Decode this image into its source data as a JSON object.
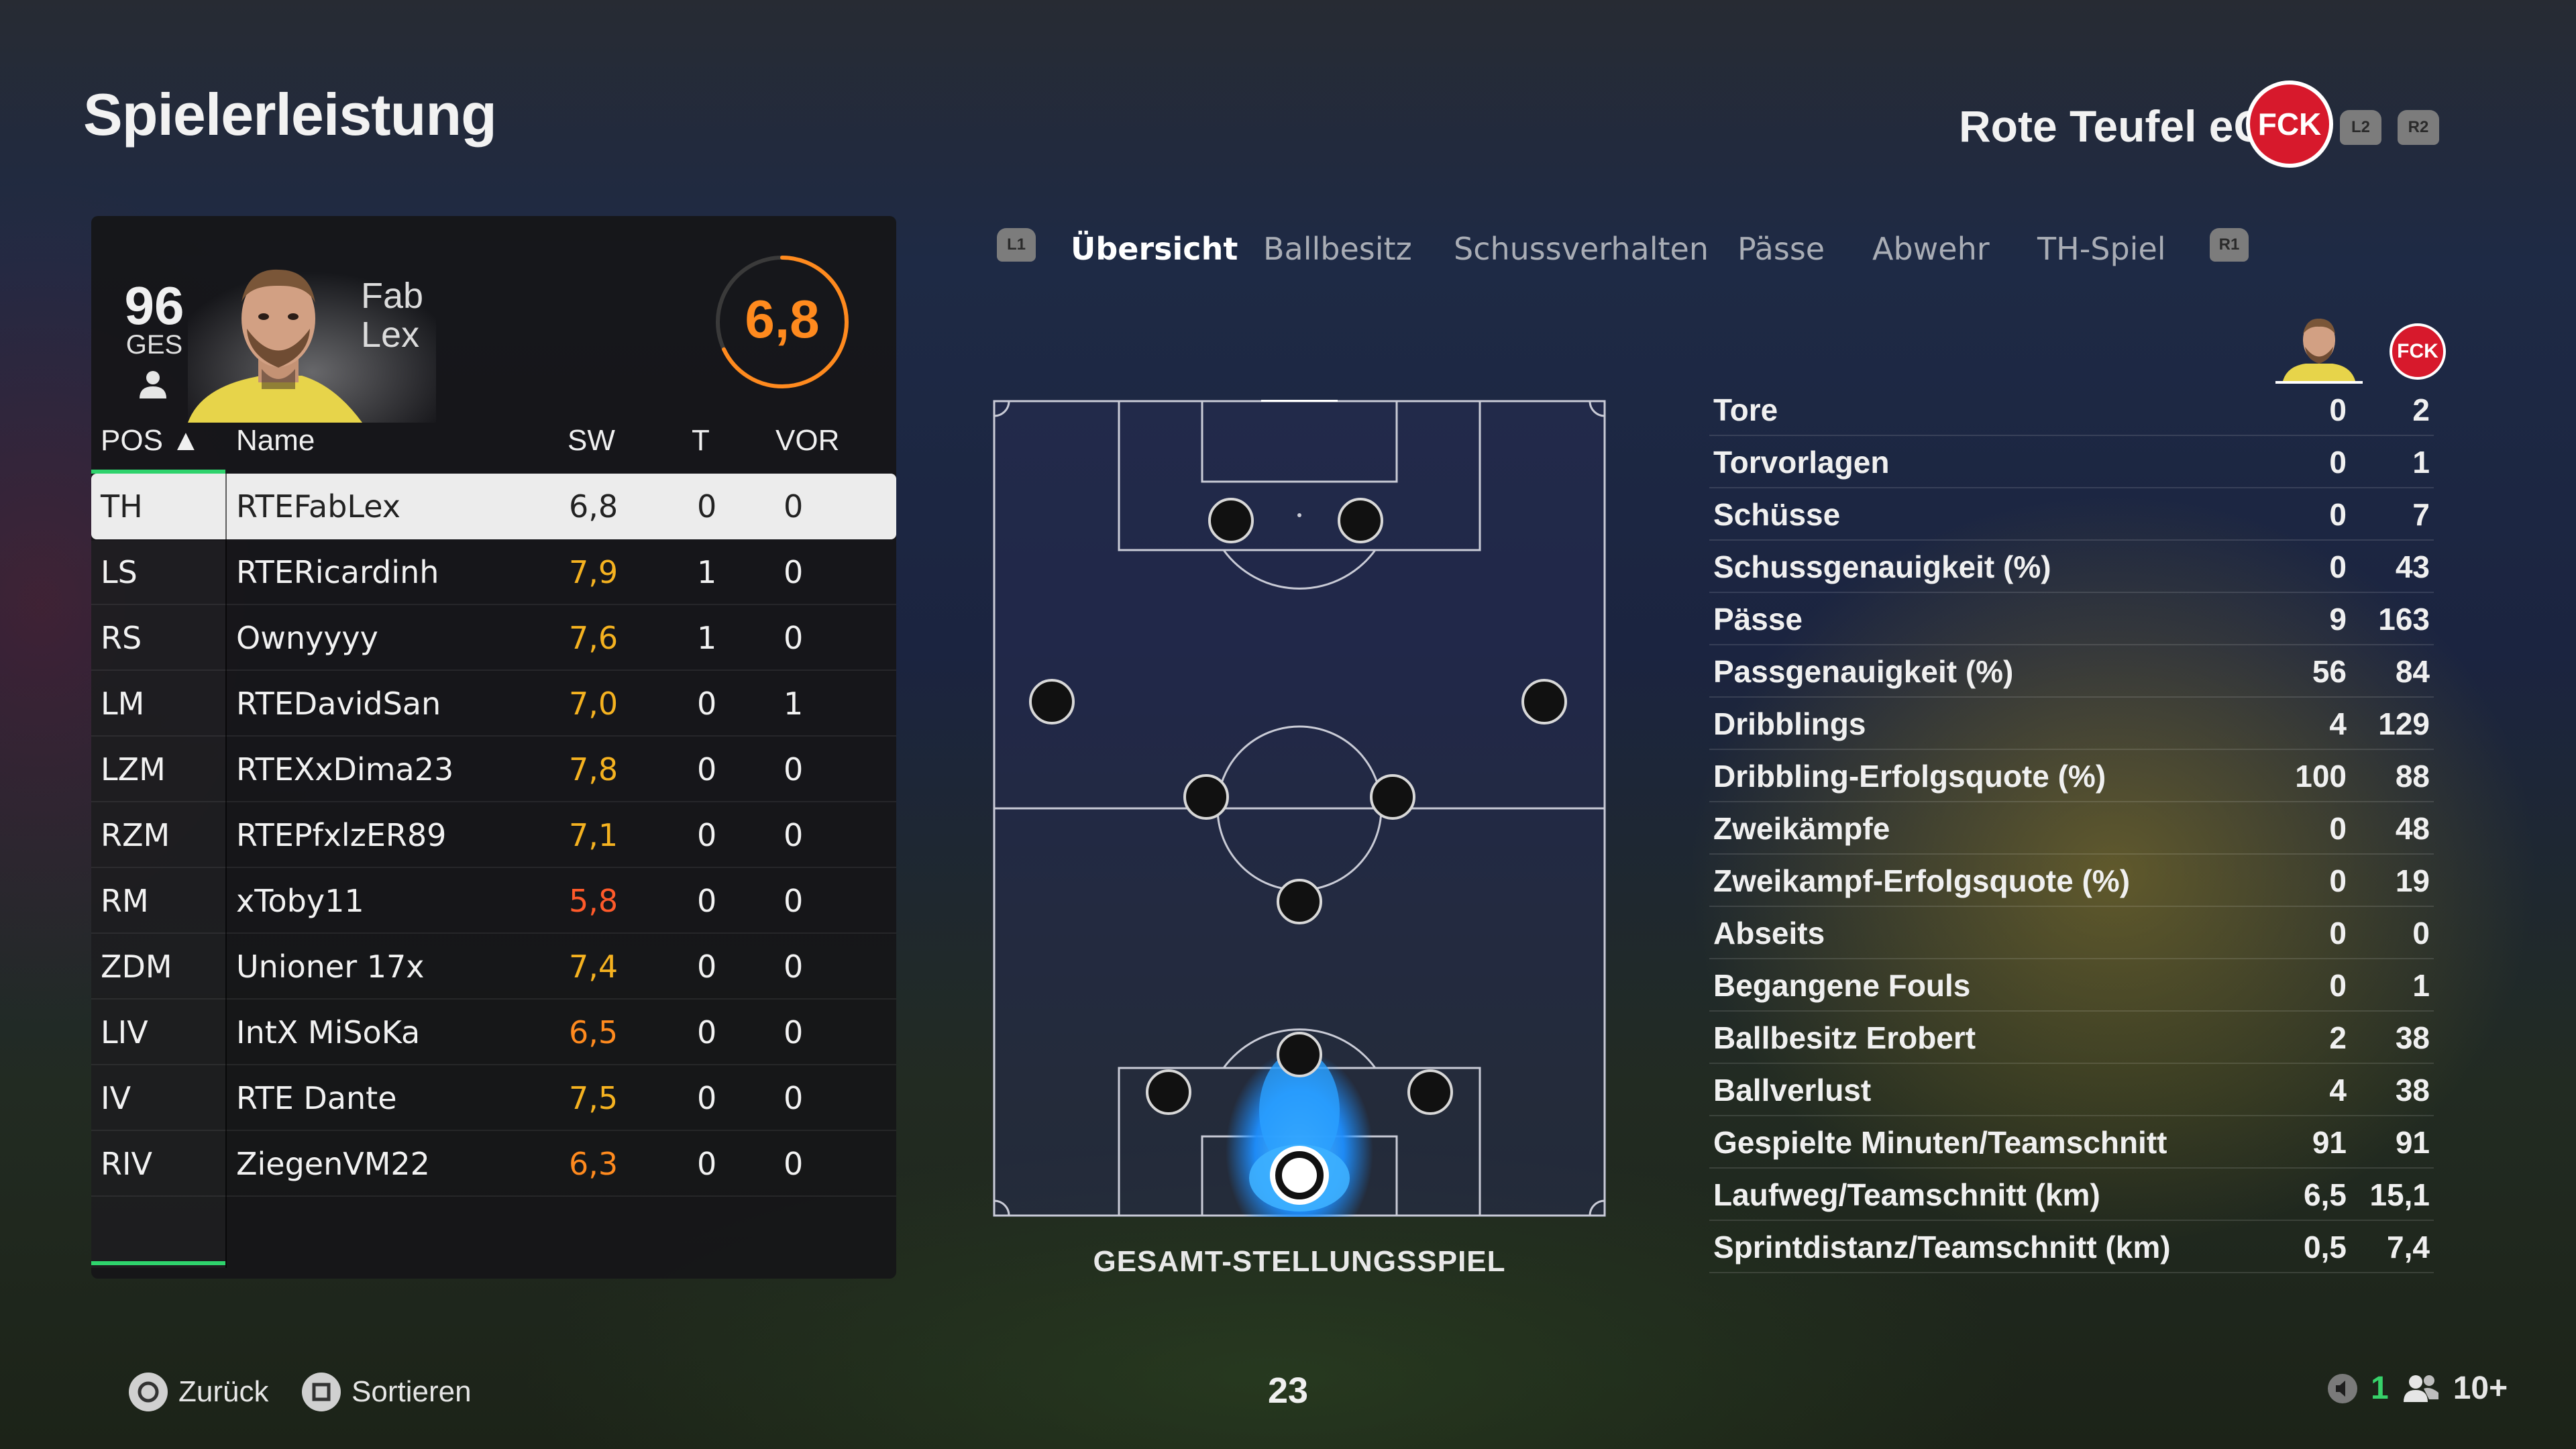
{
  "header": {
    "title": "Spielerleistung",
    "club_name": "Rote Teufel eC",
    "club_logo_text": "FCK",
    "shoulder_left": "L2",
    "shoulder_right": "R2"
  },
  "player_card": {
    "overall": "96",
    "overall_label": "GES",
    "first_name": "Fab",
    "last_name": "Lex",
    "match_rating": "6,8",
    "match_rating_fraction": 0.68,
    "accent_color": "#ff8a1e"
  },
  "table": {
    "headers": {
      "pos": "POS ▲",
      "name": "Name",
      "sw": "SW",
      "t": "T",
      "vor": "VOR"
    },
    "rows": [
      {
        "pos": "TH",
        "name": "RTEFabLex",
        "sw": "6,8",
        "t": "0",
        "vor": "0",
        "sw_color": "#333333",
        "selected": true
      },
      {
        "pos": "LS",
        "name": "RTERicardinh",
        "sw": "7,9",
        "t": "1",
        "vor": "0",
        "sw_color": "#f5b220"
      },
      {
        "pos": "RS",
        "name": "Ownyyyy",
        "sw": "7,6",
        "t": "1",
        "vor": "0",
        "sw_color": "#f5b220"
      },
      {
        "pos": "LM",
        "name": "RTEDavidSan",
        "sw": "7,0",
        "t": "0",
        "vor": "1",
        "sw_color": "#f5b220"
      },
      {
        "pos": "LZM",
        "name": "RTEXxDima23",
        "sw": "7,8",
        "t": "0",
        "vor": "0",
        "sw_color": "#f5b220"
      },
      {
        "pos": "RZM",
        "name": "RTEPfxlzER89",
        "sw": "7,1",
        "t": "0",
        "vor": "0",
        "sw_color": "#f5b220"
      },
      {
        "pos": "RM",
        "name": "xToby11",
        "sw": "5,8",
        "t": "0",
        "vor": "0",
        "sw_color": "#ff5a2a"
      },
      {
        "pos": "ZDM",
        "name": "Unioner 17x",
        "sw": "7,4",
        "t": "0",
        "vor": "0",
        "sw_color": "#f5b220"
      },
      {
        "pos": "LIV",
        "name": "IntX MiSoKa",
        "sw": "6,5",
        "t": "0",
        "vor": "0",
        "sw_color": "#ff8a1e"
      },
      {
        "pos": "IV",
        "name": "RTE Dante",
        "sw": "7,5",
        "t": "0",
        "vor": "0",
        "sw_color": "#f5b220"
      },
      {
        "pos": "RIV",
        "name": "ZiegenVM22",
        "sw": "6,3",
        "t": "0",
        "vor": "0",
        "sw_color": "#ff8a1e"
      }
    ]
  },
  "tabs": {
    "left_glyph": "L1",
    "right_glyph": "R1",
    "items": [
      "Übersicht",
      "Ballbesitz",
      "Schussverhalten",
      "Pässe",
      "Abwehr",
      "TH-Spiel"
    ],
    "active": 0
  },
  "pitch": {
    "label": "GESAMT-STELLUNGSSPIEL"
  },
  "stats": {
    "rows": [
      {
        "label": "Tore",
        "player": "0",
        "team": "2"
      },
      {
        "label": "Torvorlagen",
        "player": "0",
        "team": "1"
      },
      {
        "label": "Schüsse",
        "player": "0",
        "team": "7"
      },
      {
        "label": "Schussgenauigkeit (%)",
        "player": "0",
        "team": "43"
      },
      {
        "label": "Pässe",
        "player": "9",
        "team": "163"
      },
      {
        "label": "Passgenauigkeit (%)",
        "player": "56",
        "team": "84"
      },
      {
        "label": "Dribblings",
        "player": "4",
        "team": "129"
      },
      {
        "label": "Dribbling-Erfolgsquote (%)",
        "player": "100",
        "team": "88"
      },
      {
        "label": "Zweikämpfe",
        "player": "0",
        "team": "48"
      },
      {
        "label": "Zweikampf-Erfolgsquote (%)",
        "player": "0",
        "team": "19"
      },
      {
        "label": "Abseits",
        "player": "0",
        "team": "0"
      },
      {
        "label": "Begangene Fouls",
        "player": "0",
        "team": "1"
      },
      {
        "label": "Ballbesitz Erobert",
        "player": "2",
        "team": "38"
      },
      {
        "label": "Ballverlust",
        "player": "4",
        "team": "38"
      },
      {
        "label": "Gespielte Minuten/Teamschnitt",
        "player": "91",
        "team": "91"
      },
      {
        "label": "Laufweg/Teamschnitt (km)",
        "player": "6,5",
        "team": "15,1"
      },
      {
        "label": "Sprintdistanz/Teamschnitt (km)",
        "player": "0,5",
        "team": "7,4"
      }
    ]
  },
  "footer": {
    "back_label": "Zurück",
    "sort_label": "Sortieren",
    "page_number": "23",
    "count_green": "1",
    "players_count": "10+"
  }
}
